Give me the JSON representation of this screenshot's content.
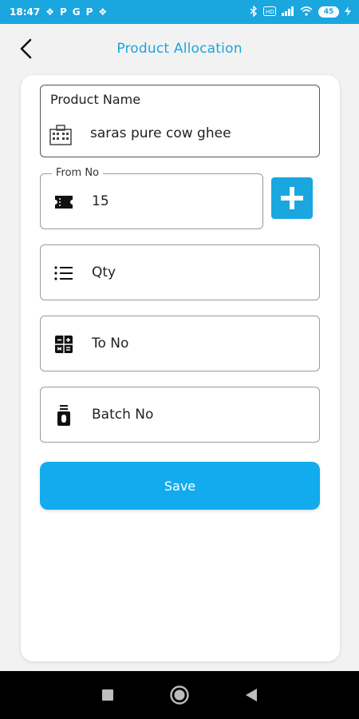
{
  "status_bar": {
    "time": "18:47",
    "app_icons": [
      "slack-icon",
      "paytm-icon",
      "google-icon",
      "paytm-icon",
      "slack-icon"
    ],
    "battery": "45"
  },
  "header": {
    "title": "Product Allocation"
  },
  "form": {
    "product_name": {
      "label": "Product Name",
      "value": "saras pure cow ghee"
    },
    "from_no": {
      "label": "From No",
      "value": "15"
    },
    "qty": {
      "placeholder": "Qty"
    },
    "to_no": {
      "placeholder": "To No"
    },
    "batch_no": {
      "placeholder": "Batch No"
    },
    "save_label": "Save"
  },
  "colors": {
    "accent": "#1aa6df",
    "button": "#12acee"
  }
}
